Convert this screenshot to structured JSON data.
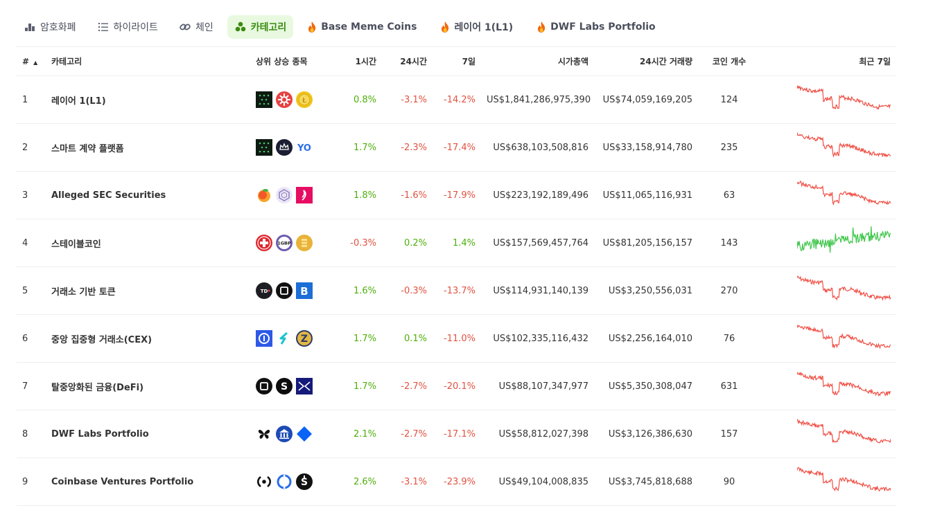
{
  "tabs": [
    {
      "label": "암호화폐",
      "icon": "bar-chart-icon",
      "active": false
    },
    {
      "label": "하이라이트",
      "icon": "list-icon",
      "active": false
    },
    {
      "label": "체인",
      "icon": "link-icon",
      "active": false
    },
    {
      "label": "카테고리",
      "icon": "category-clover-icon",
      "active": true
    },
    {
      "label": "Base Meme Coins",
      "icon": "fire-icon",
      "active": false
    },
    {
      "label": "레이어 1(L1)",
      "icon": "fire-icon",
      "active": false
    },
    {
      "label": "DWF Labs Portfolio",
      "icon": "fire-icon",
      "active": false
    }
  ],
  "table": {
    "headers": {
      "rank": "#",
      "category": "카테고리",
      "top_gainers": "상위 상승 종목",
      "h1": "1시간",
      "h24": "24시간",
      "d7": "7일",
      "market_cap": "시가총액",
      "volume": "24시간 거래량",
      "coins": "코인 개수",
      "last7": "최근 7일"
    },
    "rows": [
      {
        "rank": "1",
        "name": "레이어 1(L1)",
        "h1": "0.8%",
        "h24": "-3.1%",
        "d7": "-14.2%",
        "mcap": "US$1,841,286,975,390",
        "vol": "US$74,059,169,205",
        "coins": "124",
        "trend": "down",
        "logos": [
          "dot-grid-token-icon",
          "red-gear-token-icon",
          "gold-coin-token-icon"
        ]
      },
      {
        "rank": "2",
        "name": "스마트 계약 플랫폼",
        "h1": "1.7%",
        "h24": "-2.3%",
        "d7": "-17.4%",
        "mcap": "US$638,103,508,816",
        "vol": "US$33,158,914,780",
        "coins": "235",
        "trend": "down",
        "logos": [
          "dot-grid-token-icon",
          "crown-token-icon",
          "yo-token-icon"
        ]
      },
      {
        "rank": "3",
        "name": "Alleged SEC Securities",
        "h1": "1.8%",
        "h24": "-1.6%",
        "d7": "-17.9%",
        "mcap": "US$223,192,189,496",
        "vol": "US$11,065,116,931",
        "coins": "63",
        "trend": "down",
        "logos": [
          "peach-token-icon",
          "hexagon-token-icon",
          "pink-square-token-icon"
        ]
      },
      {
        "rank": "4",
        "name": "스테이블코인",
        "h1": "-0.3%",
        "h24": "0.2%",
        "d7": "1.4%",
        "mcap": "US$157,569,457,764",
        "vol": "US$81,205,156,157",
        "coins": "143",
        "trend": "flat",
        "logos": [
          "swiss-cross-token-icon",
          "1gbp-token-icon",
          "gold-stack-token-icon"
        ]
      },
      {
        "rank": "5",
        "name": "거래소 기반 토큰",
        "h1": "1.6%",
        "h24": "-0.3%",
        "d7": "-13.7%",
        "mcap": "US$114,931,140,139",
        "vol": "US$3,250,556,031",
        "coins": "270",
        "trend": "down",
        "logos": [
          "dark-circle-token-icon",
          "square-outline-token-icon",
          "blue-b-token-icon"
        ]
      },
      {
        "rank": "6",
        "name": "중앙 집중형 거래소(CEX)",
        "h1": "1.7%",
        "h24": "0.1%",
        "d7": "-11.0%",
        "mcap": "US$102,335,116,432",
        "vol": "US$2,256,164,010",
        "coins": "76",
        "trend": "down",
        "logos": [
          "blue-ring-token-icon",
          "teal-s-token-icon",
          "gold-z-token-icon"
        ]
      },
      {
        "rank": "7",
        "name": "탈중앙화된 금융(DeFi)",
        "h1": "1.7%",
        "h24": "-2.7%",
        "d7": "-20.1%",
        "mcap": "US$88,107,347,977",
        "vol": "US$5,350,308,047",
        "coins": "631",
        "trend": "down",
        "logos": [
          "square-outline-token-icon",
          "black-s-token-icon",
          "navy-x-token-icon"
        ]
      },
      {
        "rank": "8",
        "name": "DWF Labs Portfolio",
        "h1": "2.1%",
        "h24": "-2.7%",
        "d7": "-17.1%",
        "mcap": "US$58,812,027,398",
        "vol": "US$3,126,386,630",
        "coins": "157",
        "trend": "down",
        "logos": [
          "butterfly-token-icon",
          "bank-token-icon",
          "blue-diamond-token-icon"
        ]
      },
      {
        "rank": "9",
        "name": "Coinbase Ventures Portfolio",
        "h1": "2.6%",
        "h24": "-3.1%",
        "d7": "-23.9%",
        "mcap": "US$49,104,008,835",
        "vol": "US$3,745,818,688",
        "coins": "90",
        "trend": "down",
        "logos": [
          "signal-token-icon",
          "blue-half-circle-token-icon",
          "black-dollar-token-icon"
        ]
      }
    ]
  },
  "colors": {
    "positive": "#4eaf0a",
    "negative": "#e15241",
    "spark_down": "#f04e44",
    "spark_up": "#3fc64a",
    "active_tab_bg": "#e8f9e0",
    "active_tab_text": "#3a8b0f"
  }
}
